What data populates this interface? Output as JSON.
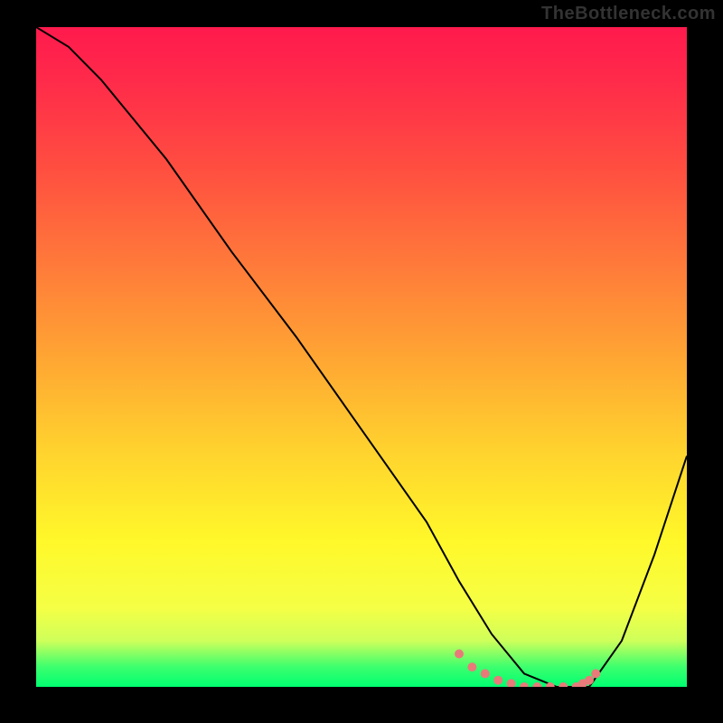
{
  "watermark": "TheBottleneck.com",
  "chart_data": {
    "type": "line",
    "title": "",
    "xlabel": "",
    "ylabel": "",
    "x_range": [
      0,
      100
    ],
    "y_range": [
      0,
      100
    ],
    "grid": false,
    "legend": false,
    "axes_visible": false,
    "background_gradient": {
      "direction": "vertical",
      "stops": [
        {
          "pos": 0.0,
          "color": "#ff1a4d"
        },
        {
          "pos": 0.5,
          "color": "#ffa533"
        },
        {
          "pos": 0.8,
          "color": "#fff82a"
        },
        {
          "pos": 0.97,
          "color": "#3cff6e"
        },
        {
          "pos": 1.0,
          "color": "#00ff70"
        }
      ]
    },
    "series": [
      {
        "name": "curve",
        "color": "#000000",
        "width": 2,
        "x": [
          0,
          5,
          10,
          20,
          30,
          40,
          50,
          60,
          65,
          70,
          75,
          80,
          85,
          90,
          95,
          100
        ],
        "y": [
          100,
          97,
          92,
          80,
          66,
          53,
          39,
          25,
          16,
          8,
          2,
          0,
          0,
          7,
          20,
          35
        ]
      }
    ],
    "highlights": {
      "name": "bottleneck-range",
      "color": "#e97a7a",
      "style": "dotted",
      "x": [
        65,
        67,
        69,
        71,
        73,
        75,
        77,
        79,
        81,
        83,
        84,
        85,
        86
      ],
      "y": [
        5,
        3,
        2,
        1,
        0.5,
        0,
        0,
        0,
        0,
        0,
        0.5,
        1,
        2
      ]
    }
  }
}
